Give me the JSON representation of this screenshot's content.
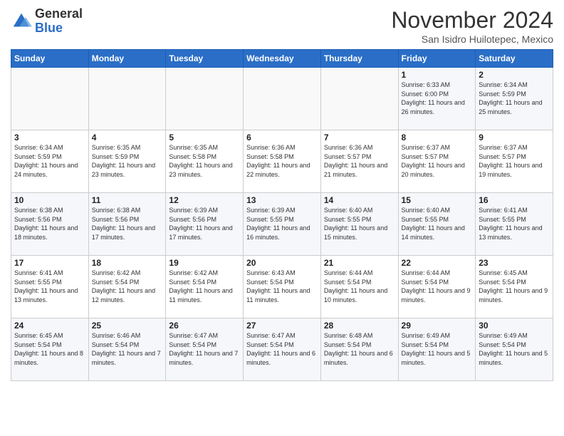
{
  "header": {
    "logo_general": "General",
    "logo_blue": "Blue",
    "month_title": "November 2024",
    "subtitle": "San Isidro Huilotepec, Mexico"
  },
  "weekdays": [
    "Sunday",
    "Monday",
    "Tuesday",
    "Wednesday",
    "Thursday",
    "Friday",
    "Saturday"
  ],
  "weeks": [
    [
      {
        "day": "",
        "info": ""
      },
      {
        "day": "",
        "info": ""
      },
      {
        "day": "",
        "info": ""
      },
      {
        "day": "",
        "info": ""
      },
      {
        "day": "",
        "info": ""
      },
      {
        "day": "1",
        "info": "Sunrise: 6:33 AM\nSunset: 6:00 PM\nDaylight: 11 hours and 26 minutes."
      },
      {
        "day": "2",
        "info": "Sunrise: 6:34 AM\nSunset: 5:59 PM\nDaylight: 11 hours and 25 minutes."
      }
    ],
    [
      {
        "day": "3",
        "info": "Sunrise: 6:34 AM\nSunset: 5:59 PM\nDaylight: 11 hours and 24 minutes."
      },
      {
        "day": "4",
        "info": "Sunrise: 6:35 AM\nSunset: 5:59 PM\nDaylight: 11 hours and 23 minutes."
      },
      {
        "day": "5",
        "info": "Sunrise: 6:35 AM\nSunset: 5:58 PM\nDaylight: 11 hours and 23 minutes."
      },
      {
        "day": "6",
        "info": "Sunrise: 6:36 AM\nSunset: 5:58 PM\nDaylight: 11 hours and 22 minutes."
      },
      {
        "day": "7",
        "info": "Sunrise: 6:36 AM\nSunset: 5:57 PM\nDaylight: 11 hours and 21 minutes."
      },
      {
        "day": "8",
        "info": "Sunrise: 6:37 AM\nSunset: 5:57 PM\nDaylight: 11 hours and 20 minutes."
      },
      {
        "day": "9",
        "info": "Sunrise: 6:37 AM\nSunset: 5:57 PM\nDaylight: 11 hours and 19 minutes."
      }
    ],
    [
      {
        "day": "10",
        "info": "Sunrise: 6:38 AM\nSunset: 5:56 PM\nDaylight: 11 hours and 18 minutes."
      },
      {
        "day": "11",
        "info": "Sunrise: 6:38 AM\nSunset: 5:56 PM\nDaylight: 11 hours and 17 minutes."
      },
      {
        "day": "12",
        "info": "Sunrise: 6:39 AM\nSunset: 5:56 PM\nDaylight: 11 hours and 17 minutes."
      },
      {
        "day": "13",
        "info": "Sunrise: 6:39 AM\nSunset: 5:55 PM\nDaylight: 11 hours and 16 minutes."
      },
      {
        "day": "14",
        "info": "Sunrise: 6:40 AM\nSunset: 5:55 PM\nDaylight: 11 hours and 15 minutes."
      },
      {
        "day": "15",
        "info": "Sunrise: 6:40 AM\nSunset: 5:55 PM\nDaylight: 11 hours and 14 minutes."
      },
      {
        "day": "16",
        "info": "Sunrise: 6:41 AM\nSunset: 5:55 PM\nDaylight: 11 hours and 13 minutes."
      }
    ],
    [
      {
        "day": "17",
        "info": "Sunrise: 6:41 AM\nSunset: 5:55 PM\nDaylight: 11 hours and 13 minutes."
      },
      {
        "day": "18",
        "info": "Sunrise: 6:42 AM\nSunset: 5:54 PM\nDaylight: 11 hours and 12 minutes."
      },
      {
        "day": "19",
        "info": "Sunrise: 6:42 AM\nSunset: 5:54 PM\nDaylight: 11 hours and 11 minutes."
      },
      {
        "day": "20",
        "info": "Sunrise: 6:43 AM\nSunset: 5:54 PM\nDaylight: 11 hours and 11 minutes."
      },
      {
        "day": "21",
        "info": "Sunrise: 6:44 AM\nSunset: 5:54 PM\nDaylight: 11 hours and 10 minutes."
      },
      {
        "day": "22",
        "info": "Sunrise: 6:44 AM\nSunset: 5:54 PM\nDaylight: 11 hours and 9 minutes."
      },
      {
        "day": "23",
        "info": "Sunrise: 6:45 AM\nSunset: 5:54 PM\nDaylight: 11 hours and 9 minutes."
      }
    ],
    [
      {
        "day": "24",
        "info": "Sunrise: 6:45 AM\nSunset: 5:54 PM\nDaylight: 11 hours and 8 minutes."
      },
      {
        "day": "25",
        "info": "Sunrise: 6:46 AM\nSunset: 5:54 PM\nDaylight: 11 hours and 7 minutes."
      },
      {
        "day": "26",
        "info": "Sunrise: 6:47 AM\nSunset: 5:54 PM\nDaylight: 11 hours and 7 minutes."
      },
      {
        "day": "27",
        "info": "Sunrise: 6:47 AM\nSunset: 5:54 PM\nDaylight: 11 hours and 6 minutes."
      },
      {
        "day": "28",
        "info": "Sunrise: 6:48 AM\nSunset: 5:54 PM\nDaylight: 11 hours and 6 minutes."
      },
      {
        "day": "29",
        "info": "Sunrise: 6:49 AM\nSunset: 5:54 PM\nDaylight: 11 hours and 5 minutes."
      },
      {
        "day": "30",
        "info": "Sunrise: 6:49 AM\nSunset: 5:54 PM\nDaylight: 11 hours and 5 minutes."
      }
    ]
  ]
}
